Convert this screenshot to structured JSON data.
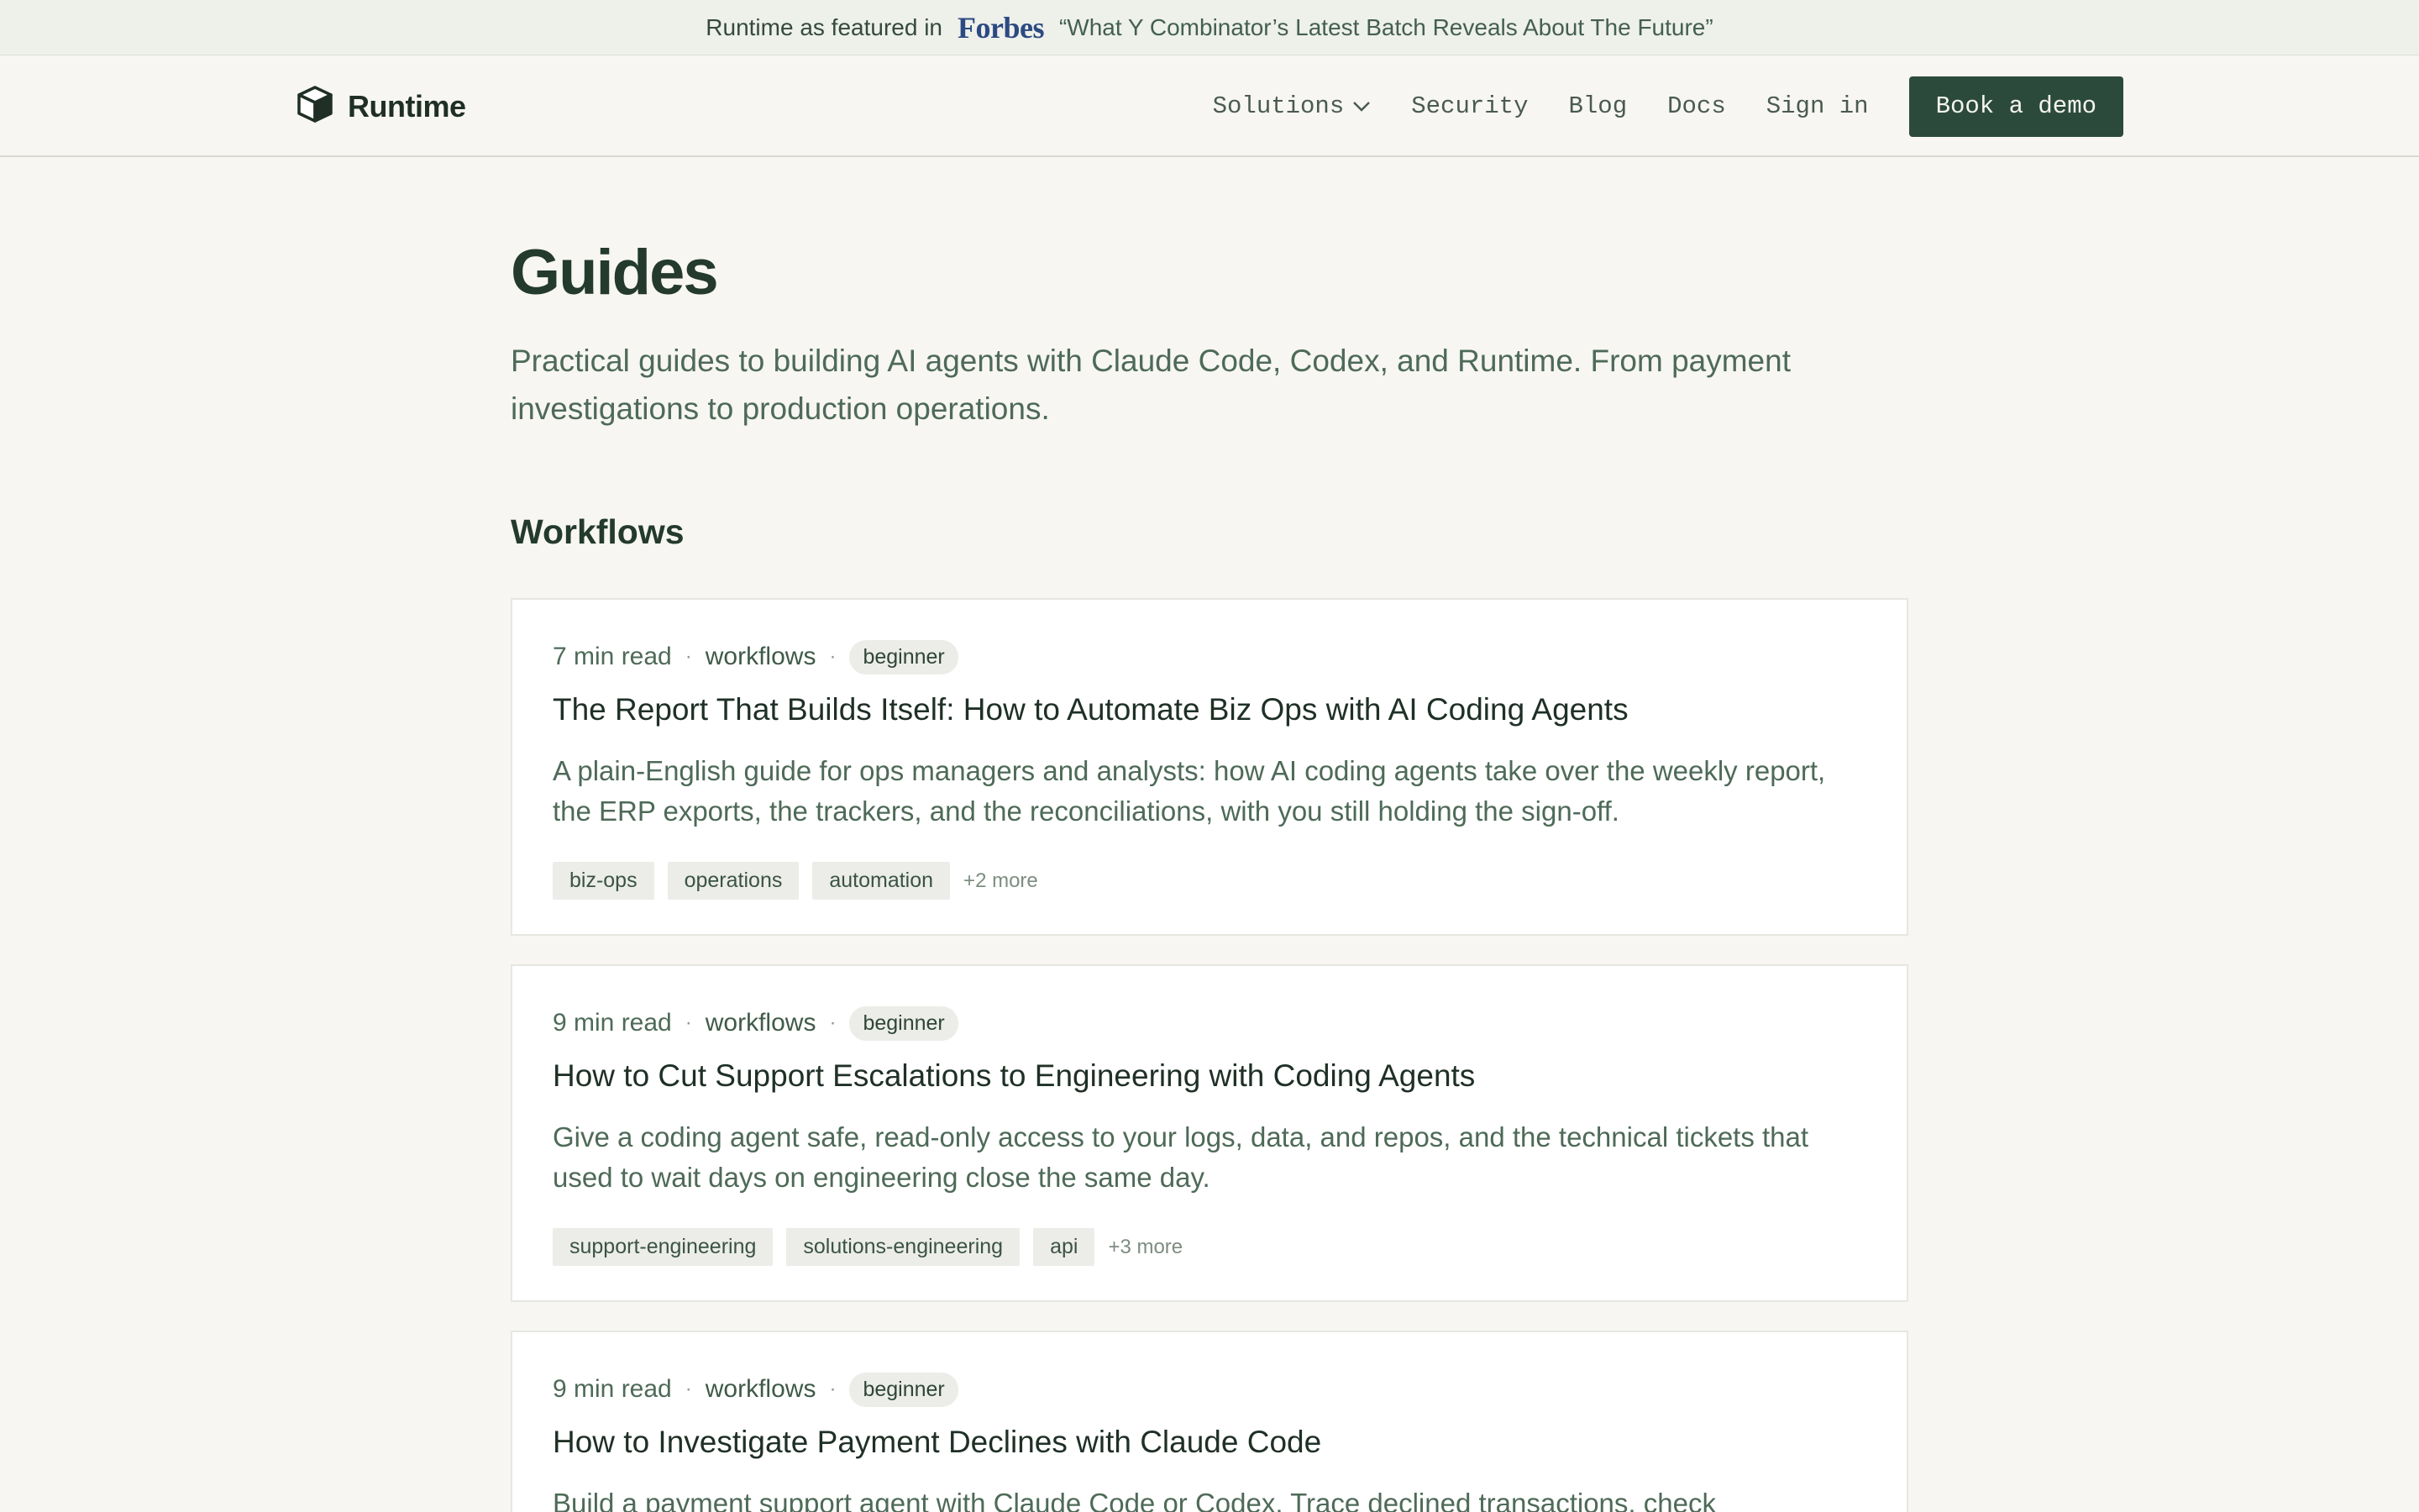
{
  "banner": {
    "featured": "Runtime as featured in",
    "publication": "Forbes",
    "quote": "“What Y Combinator’s Latest Batch Reveals About The Future”"
  },
  "nav": {
    "brand": "Runtime",
    "links": [
      "Solutions",
      "Security",
      "Blog",
      "Docs",
      "Sign in"
    ],
    "cta": "Book a demo"
  },
  "page": {
    "title": "Guides",
    "subtitle": "Practical guides to building AI agents with Claude Code, Codex, and Runtime. From payment investigations to production operations.",
    "section": "Workflows"
  },
  "guides": [
    {
      "read_time": "7 min read",
      "category": "workflows",
      "level": "beginner",
      "title": "The Report That Builds Itself: How to Automate Biz Ops with AI Coding Agents",
      "description": "A plain-English guide for ops managers and analysts: how AI coding agents take over the weekly report, the ERP exports, the trackers, and the reconciliations, with you still holding the sign-off.",
      "tags": [
        "biz-ops",
        "operations",
        "automation"
      ],
      "more": "+2 more"
    },
    {
      "read_time": "9 min read",
      "category": "workflows",
      "level": "beginner",
      "title": "How to Cut Support Escalations to Engineering with Coding Agents",
      "description": "Give a coding agent safe, read-only access to your logs, data, and repos, and the technical tickets that used to wait days on engineering close the same day.",
      "tags": [
        "support-engineering",
        "solutions-engineering",
        "api"
      ],
      "more": "+3 more"
    },
    {
      "read_time": "9 min read",
      "category": "workflows",
      "level": "beginner",
      "title": "How to Investigate Payment Declines with Claude Code",
      "description": "Build a payment support agent with Claude Code or Codex. Trace declined transactions, check",
      "tags": [],
      "more": ""
    }
  ]
}
